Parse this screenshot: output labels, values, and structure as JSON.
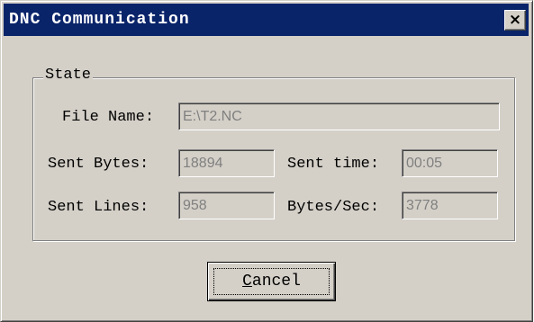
{
  "window": {
    "title": "DNC Communication",
    "close_glyph": "×"
  },
  "group": {
    "label": "State"
  },
  "fields": {
    "file_name": {
      "label": "File Name:",
      "value": "E:\\T2.NC"
    },
    "sent_bytes": {
      "label": "Sent Bytes:",
      "value": "18894"
    },
    "sent_time": {
      "label": "Sent time:",
      "value": "00:05"
    },
    "sent_lines": {
      "label": "Sent Lines:",
      "value": "958"
    },
    "bytes_sec": {
      "label": "Bytes/Sec:",
      "value": "3778"
    }
  },
  "buttons": {
    "cancel_first": "C",
    "cancel_rest": "ancel"
  },
  "colors": {
    "titlebar": "#0a246a",
    "face": "#d4d0c8",
    "disabled_text": "#808080"
  }
}
